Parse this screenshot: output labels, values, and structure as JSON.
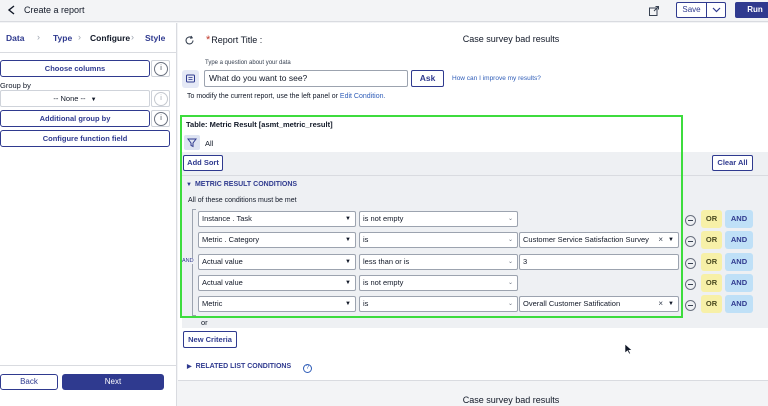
{
  "topbar": {
    "title": "Create a report",
    "save_label": "Save",
    "run_label": "Run"
  },
  "steps": [
    "Data",
    "Type",
    "Configure",
    "Style"
  ],
  "active_step": "Configure",
  "left_panel": {
    "choose_columns": "Choose columns",
    "group_by_label": "Group by",
    "group_by_value": "-- None --",
    "additional_group_by": "Additional group by",
    "configure_function_field": "Configure function field",
    "back_label": "Back",
    "next_label": "Next"
  },
  "report": {
    "title_label": "Report Title :",
    "title_value": "Case survey bad results",
    "ask_hint": "Type a question about your data",
    "ask_placeholder": "What do you want to see?",
    "ask_button": "Ask",
    "improve_link": "How can I improve my results?",
    "modify_text": "To modify the current report, use the left panel or ",
    "modify_link": "Edit Condition."
  },
  "conditions": {
    "table_label": "Table: Metric Result [asmt_metric_result]",
    "breadcrumb": "All",
    "add_sort": "Add Sort",
    "clear_all": "Clear All",
    "section_title": "METRIC RESULT CONDITIONS",
    "all_met_text": "All of these conditions must be met",
    "and_connector": "AND",
    "or_button": "OR",
    "and_button": "AND",
    "rows": [
      {
        "field": "Instance . Task",
        "operator": "is not empty",
        "value": ""
      },
      {
        "field": "Metric . Category",
        "operator": "is",
        "value": "Customer Service Satisfaction Survey"
      },
      {
        "field": "Actual value",
        "operator": "less than or is",
        "value": "3"
      },
      {
        "field": "Actual value",
        "operator": "is not empty",
        "value": ""
      },
      {
        "field": "Metric",
        "operator": "is",
        "value": "Overall Customer Satification"
      }
    ],
    "or_text": "or",
    "new_criteria": "New Criteria",
    "related_title": "RELATED LIST CONDITIONS"
  },
  "preview": {
    "title": "Case survey bad results"
  },
  "colors": {
    "primary": "#2f3a8f",
    "highlight_border": "#3ddc3d",
    "or_bg": "#f7f0a8",
    "and_bg": "#bfe0f7"
  }
}
